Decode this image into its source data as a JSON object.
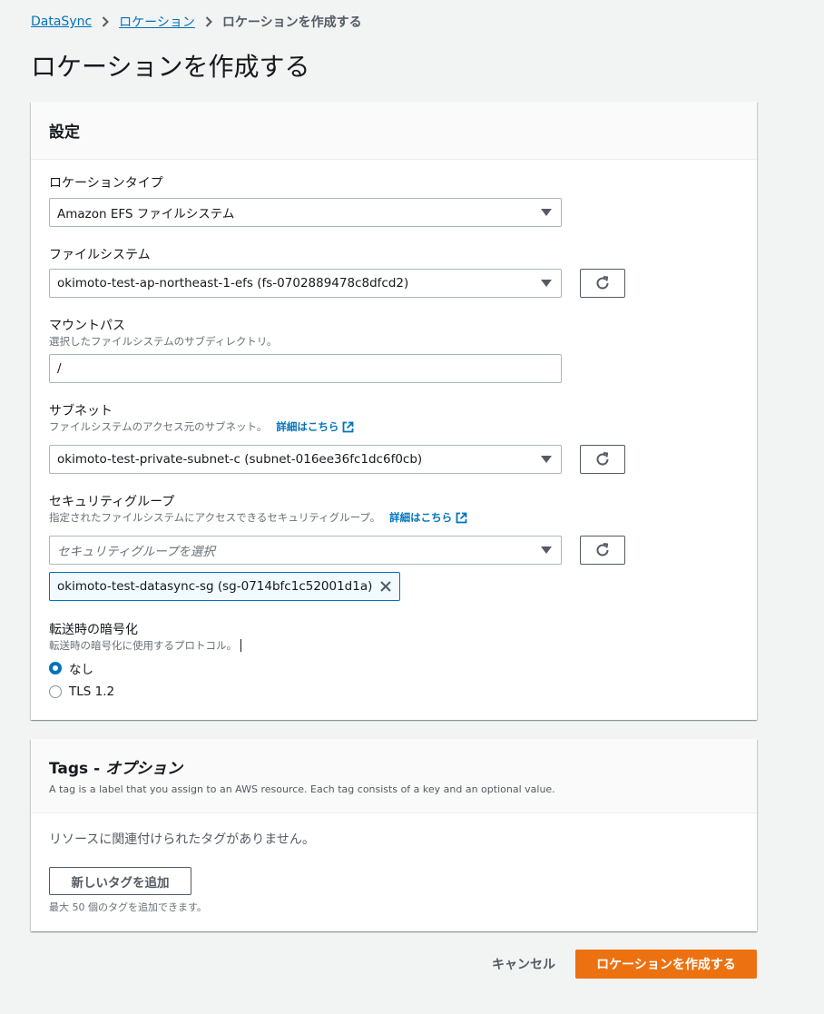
{
  "breadcrumb": {
    "items": [
      "DataSync",
      "ロケーション"
    ],
    "current": "ロケーションを作成する"
  },
  "page_title": "ロケーションを作成する",
  "settings": {
    "title": "設定",
    "location_type": {
      "label": "ロケーションタイプ",
      "value": "Amazon EFS ファイルシステム"
    },
    "file_system": {
      "label": "ファイルシステム",
      "value": "okimoto-test-ap-northeast-1-efs (fs-0702889478c8dfcd2)"
    },
    "mount_path": {
      "label": "マウントパス",
      "description": "選択したファイルシステムのサブディレクトリ。",
      "value": "/"
    },
    "subnet": {
      "label": "サブネット",
      "description": "ファイルシステムのアクセス元のサブネット。",
      "link": "詳細はこちら",
      "value": "okimoto-test-private-subnet-c (subnet-016ee36fc1dc6f0cb)"
    },
    "security_group": {
      "label": "セキュリティグループ",
      "description": "指定されたファイルシステムにアクセスできるセキュリティグループ。",
      "link": "詳細はこちら",
      "placeholder": "セキュリティグループを選択",
      "selected_token": "okimoto-test-datasync-sg (sg-0714bfc1c52001d1a)"
    },
    "encryption": {
      "label": "転送時の暗号化",
      "description": "転送時の暗号化に使用するプロトコル。",
      "options": [
        "なし",
        "TLS 1.2"
      ],
      "selected": "なし"
    }
  },
  "tags": {
    "title": "Tags - ",
    "title_italic": "オプション",
    "description": "A tag is a label that you assign to an AWS resource. Each tag consists of a key and an optional value.",
    "empty_text": "リソースに関連付けられたタグがありません。",
    "add_button": "新しいタグを追加",
    "limit_text": "最大 50 個のタグを追加できます。"
  },
  "footer": {
    "cancel_label": "キャンセル",
    "create_label": "ロケーションを作成する"
  },
  "colors": {
    "link": "#0073bb",
    "primary_button": "#ec7211",
    "background": "#f2f3f3"
  }
}
